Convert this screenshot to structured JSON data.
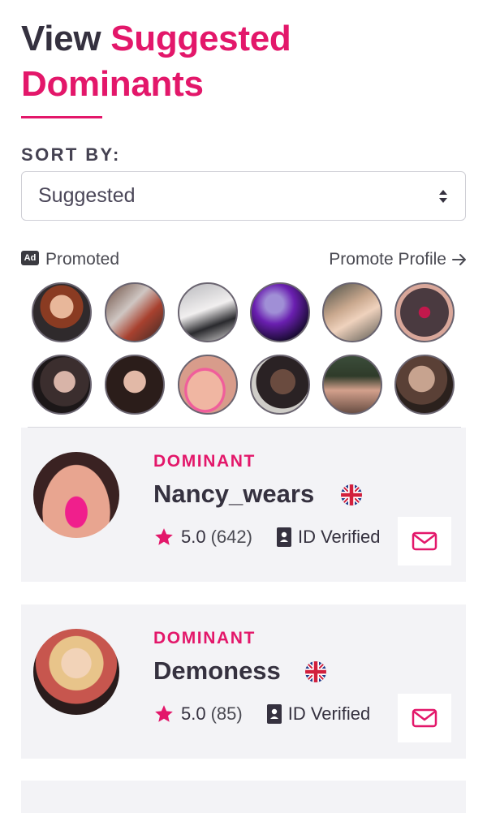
{
  "header": {
    "title_plain": "View",
    "title_accent_1": "Suggested",
    "title_accent_2": "Dominants"
  },
  "sort": {
    "label": "SORT BY:",
    "selected": "Suggested"
  },
  "promoted": {
    "badge": "Ad",
    "label": "Promoted",
    "promote_link": "Promote Profile"
  },
  "profiles": [
    {
      "role": "DOMINANT",
      "name": "Nancy_wears",
      "rating": "5.0",
      "reviews": "(642)",
      "verified": "ID Verified"
    },
    {
      "role": "DOMINANT",
      "name": "Demoness",
      "rating": "5.0",
      "reviews": "(85)",
      "verified": "ID Verified"
    }
  ],
  "colors": {
    "accent": "#e3176a",
    "text_dark": "#35313f",
    "card_bg": "#f3f3f6"
  },
  "icons": {
    "sort": "sort-arrows-icon",
    "arrow": "arrow-right-icon",
    "star": "star-icon",
    "id": "id-badge-icon",
    "mail": "envelope-icon",
    "flag": "uk-flag-icon"
  }
}
